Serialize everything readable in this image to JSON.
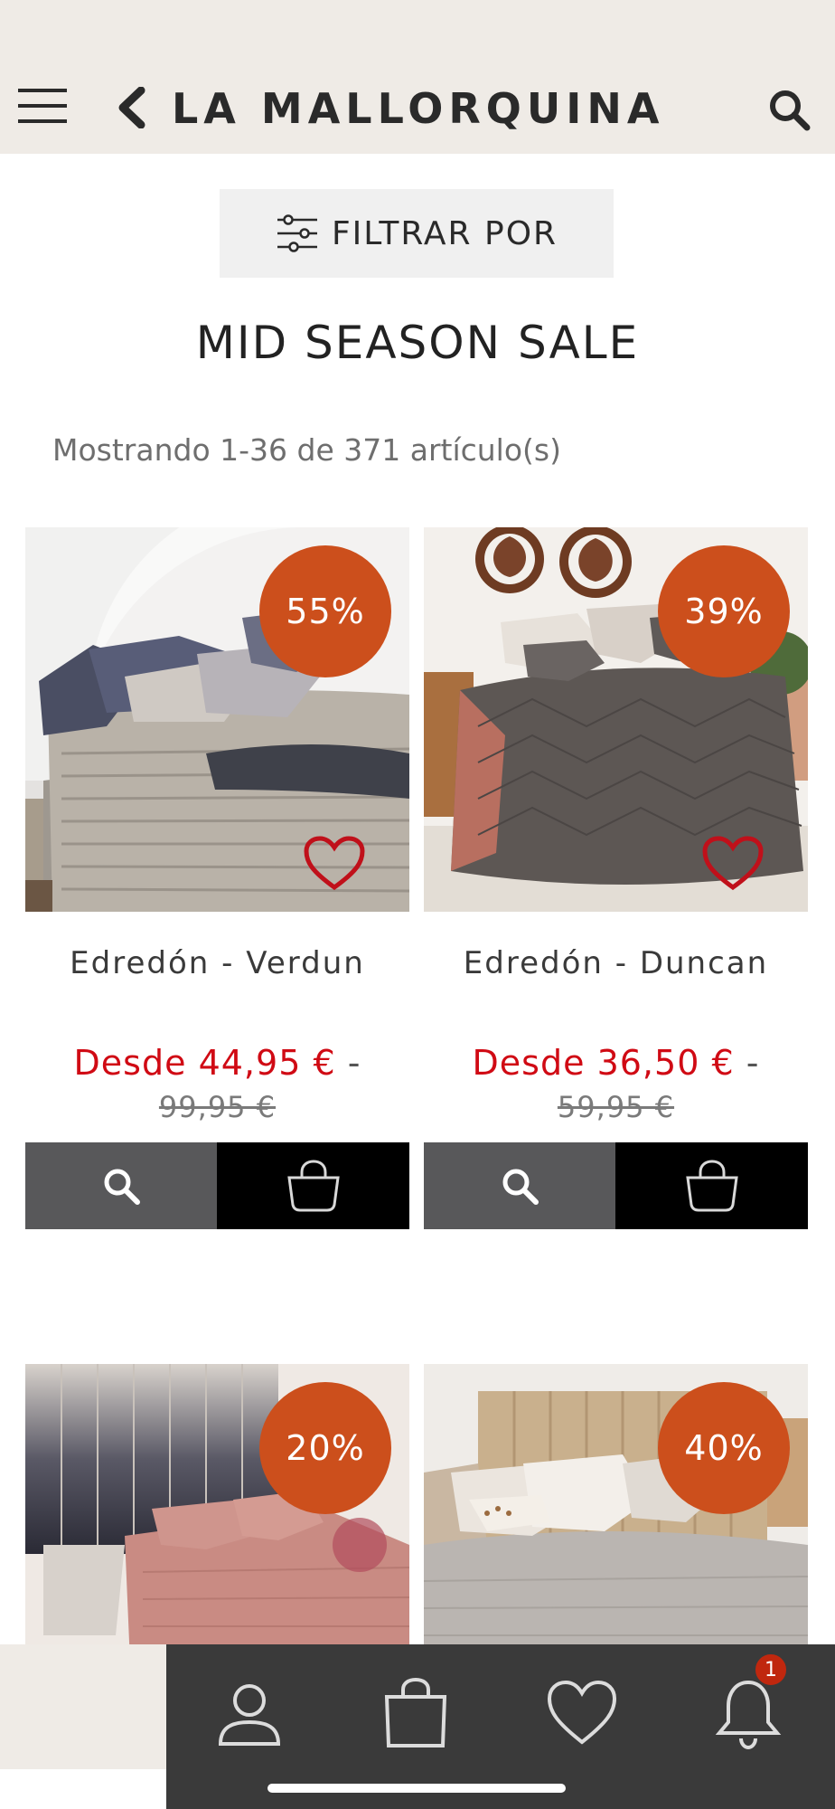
{
  "header": {
    "brand": "LA MALLORQUINA",
    "icons": [
      "menu-icon",
      "back-chevron-icon",
      "search-icon"
    ]
  },
  "filter": {
    "label": "FILTRAR POR",
    "icon": "sliders-icon"
  },
  "page": {
    "title": "MID SEASON SALE",
    "count_text": "Mostrando 1-36 de 371 artículo(s)"
  },
  "products": [
    {
      "discount": "55%",
      "name": "Edredón - Verdun",
      "price_prefix": "Desde",
      "price": "44,95 €",
      "separator": "-",
      "old_price": "99,95 €"
    },
    {
      "discount": "39%",
      "name": "Edredón - Duncan",
      "price_prefix": "Desde",
      "price": "36,50 €",
      "separator": "-",
      "old_price": "59,95 €"
    },
    {
      "discount": "20%"
    },
    {
      "discount": "40%"
    }
  ],
  "colors": {
    "header_bg": "#efebe6",
    "badge": "#cc4f1c",
    "sale_price": "#d00a14",
    "heart": "#c0101a",
    "tabbar": "#3a3a3a"
  },
  "tabbar": {
    "icons": [
      "user-icon",
      "bag-icon",
      "heart-icon",
      "bell-icon"
    ],
    "notification_count": "1"
  }
}
